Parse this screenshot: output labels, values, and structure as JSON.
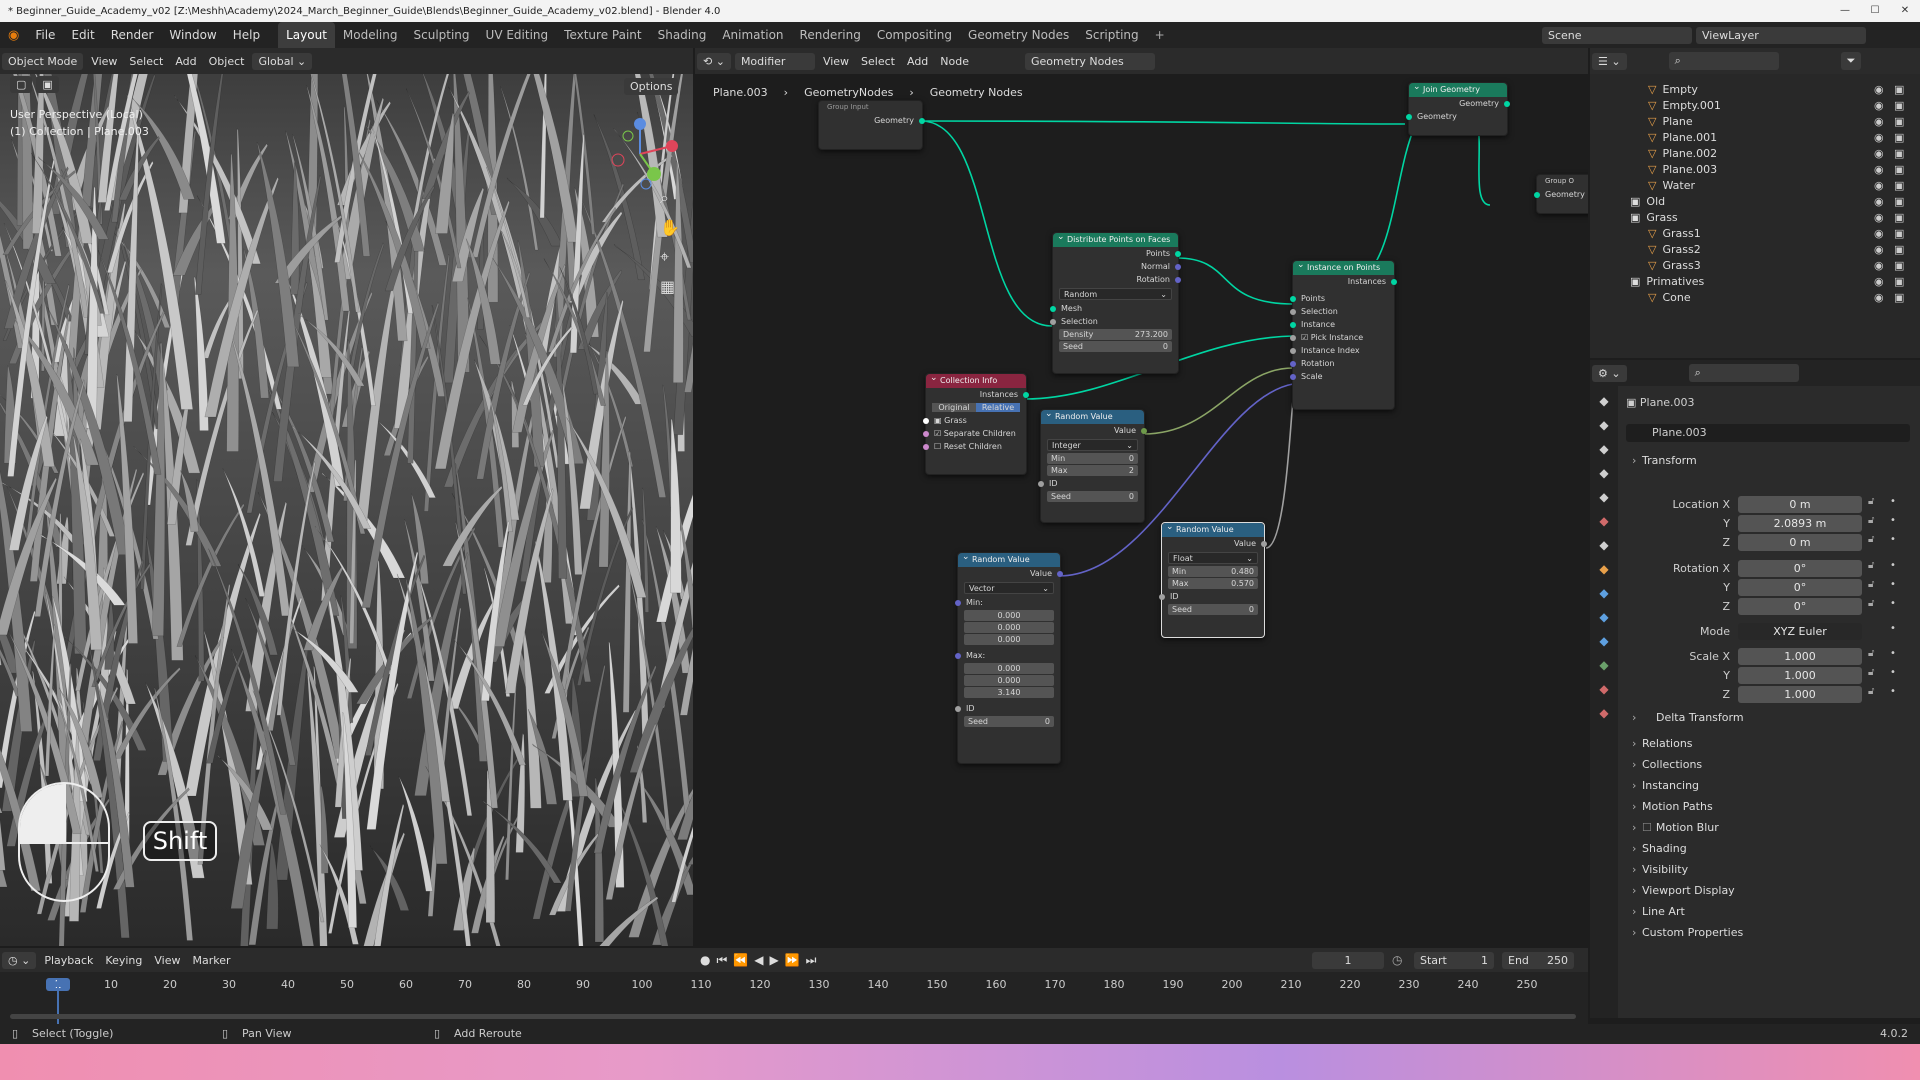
{
  "window": {
    "title": "* Beginner_Guide_Academy_v02 [Z:\\Meshh\\Academy\\2024_March_Beginner_Guide\\Blends\\Beginner_Guide_Academy_v02.blend] - Blender 4.0"
  },
  "menus": [
    "File",
    "Edit",
    "Render",
    "Window",
    "Help"
  ],
  "workspaces": [
    "Layout",
    "Modeling",
    "Sculpting",
    "UV Editing",
    "Texture Paint",
    "Shading",
    "Animation",
    "Rendering",
    "Compositing",
    "Geometry Nodes",
    "Scripting"
  ],
  "active_workspace": "Layout",
  "scene": {
    "label": "Scene",
    "viewlayer": "ViewLayer"
  },
  "viewport": {
    "mode": "Object Mode",
    "menus": [
      "View",
      "Select",
      "Add",
      "Object"
    ],
    "transform": "Global",
    "options": "Options",
    "overlay_line1": "User Perspective (Local)",
    "overlay_line2": "(1) Collection | Plane.003",
    "key_hint": "Shift"
  },
  "node_editor": {
    "editor_type": "Modifier",
    "menus": [
      "View",
      "Select",
      "Add",
      "Node"
    ],
    "tree_name": "Geometry Nodes",
    "breadcrumb": [
      "Plane.003",
      "GeometryNodes",
      "Geometry Nodes"
    ]
  },
  "nodes": {
    "group_input": {
      "title": "Group Input",
      "out": "Geometry"
    },
    "join": {
      "title": "Join Geometry",
      "out": "Geometry",
      "in": "Geometry"
    },
    "group_output": {
      "title": "Group O",
      "in": "Geometry"
    },
    "distribute": {
      "title": "Distribute Points on Faces",
      "outs": [
        "Points",
        "Normal",
        "Rotation"
      ],
      "mode": "Random",
      "ins": [
        "Mesh",
        "Selection"
      ],
      "density_label": "Density",
      "density": "273.200",
      "seed_label": "Seed",
      "seed": "0"
    },
    "instance": {
      "title": "Instance on Points",
      "out": "Instances",
      "ins": [
        "Points",
        "Selection",
        "Instance",
        "Pick Instance",
        "Instance Index",
        "Rotation",
        "Scale"
      ]
    },
    "collection": {
      "title": "Collection Info",
      "out": "Instances",
      "opt1": "Original",
      "opt2": "Relative",
      "coll": "Grass",
      "sep": "Separate Children",
      "reset": "Reset Children"
    },
    "rand1": {
      "title": "Random Value",
      "out": "Value",
      "type": "Integer",
      "min_label": "Min",
      "min": "0",
      "max_label": "Max",
      "max": "2",
      "id": "ID",
      "seed_label": "Seed",
      "seed": "0"
    },
    "rand2": {
      "title": "Random Value",
      "out": "Value",
      "type": "Float",
      "min_label": "Min",
      "min": "0.480",
      "max_label": "Max",
      "max": "0.570",
      "id": "ID",
      "seed_label": "Seed",
      "seed": "0"
    },
    "rand3": {
      "title": "Random Value",
      "out": "Value",
      "type": "Vector",
      "min_label": "Min:",
      "min": [
        "0.000",
        "0.000",
        "0.000"
      ],
      "max_label": "Max:",
      "max": [
        "0.000",
        "0.000",
        "3.140"
      ],
      "id": "ID",
      "seed_label": "Seed",
      "seed": "0"
    }
  },
  "outliner": {
    "items": [
      {
        "name": "Empty",
        "indent": 1
      },
      {
        "name": "Empty.001",
        "indent": 1
      },
      {
        "name": "Plane",
        "indent": 1
      },
      {
        "name": "Plane.001",
        "indent": 1
      },
      {
        "name": "Plane.002",
        "indent": 1
      },
      {
        "name": "Plane.003",
        "indent": 1
      },
      {
        "name": "Water",
        "indent": 1
      },
      {
        "name": "Old",
        "indent": 0
      },
      {
        "name": "Grass",
        "indent": 0
      },
      {
        "name": "Grass1",
        "indent": 1
      },
      {
        "name": "Grass2",
        "indent": 1
      },
      {
        "name": "Grass3",
        "indent": 1
      },
      {
        "name": "Primatives",
        "indent": 0
      },
      {
        "name": "Cone",
        "indent": 1
      }
    ]
  },
  "properties": {
    "object": "Plane.003",
    "data_name": "Plane.003",
    "transform": "Transform",
    "location": {
      "label_x": "Location X",
      "x": "0 m",
      "y": "2.0893 m",
      "z": "0 m"
    },
    "rotation": {
      "label_x": "Rotation X",
      "x": "0°",
      "y": "0°",
      "z": "0°"
    },
    "mode_label": "Mode",
    "mode": "XYZ Euler",
    "scale": {
      "label_x": "Scale X",
      "x": "1.000",
      "y": "1.000",
      "z": "1.000"
    },
    "axis_y": "Y",
    "axis_z": "Z",
    "sections": [
      "Delta Transform",
      "Relations",
      "Collections",
      "Instancing",
      "Motion Paths",
      "Motion Blur",
      "Shading",
      "Visibility",
      "Viewport Display",
      "Line Art",
      "Custom Properties"
    ]
  },
  "timeline": {
    "menus": [
      "Playback",
      "Keying",
      "View",
      "Marker"
    ],
    "frame": "1",
    "start_label": "Start",
    "start": "1",
    "end_label": "End",
    "end": "250",
    "ticks": [
      "1",
      "10",
      "20",
      "30",
      "40",
      "50",
      "60",
      "70",
      "80",
      "90",
      "100",
      "110",
      "120",
      "130",
      "140",
      "150",
      "160",
      "170",
      "180",
      "190",
      "200",
      "210",
      "220",
      "230",
      "240",
      "250"
    ]
  },
  "status": {
    "select": "Select (Toggle)",
    "pan": "Pan View",
    "reroute": "Add Reroute",
    "version": "4.0.2"
  }
}
